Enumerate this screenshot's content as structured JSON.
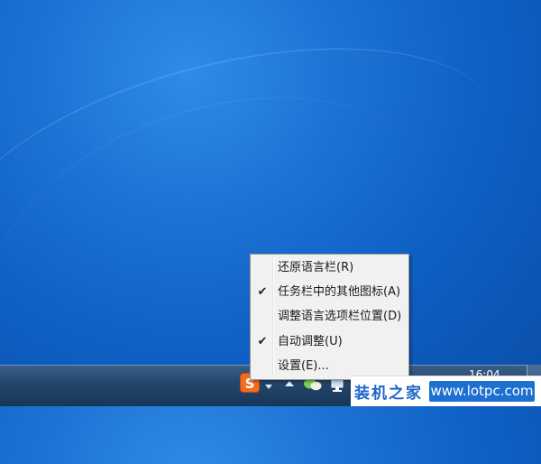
{
  "context_menu": {
    "items": [
      {
        "label": "还原语言栏(R)",
        "checked": false
      },
      {
        "label": "任务栏中的其他图标(A)",
        "checked": true
      },
      {
        "label": "调整语言选项栏位置(D)",
        "checked": false
      },
      {
        "label": "自动调整(U)",
        "checked": true
      },
      {
        "label": "设置(E)...",
        "checked": false
      }
    ],
    "check_mark": "✔"
  },
  "tray": {
    "ime_label": "S",
    "icons": [
      "sogou-ime-icon",
      "dropdown-arrow-icon",
      "show-hidden-icons-arrow",
      "wechat-icon",
      "network-icon"
    ]
  },
  "clock": {
    "time": "16:04"
  },
  "watermark": {
    "left_text": "装机之家",
    "right_text": "www.lotpc.com"
  },
  "colors": {
    "desktop": "#1d73d4",
    "taskbar": "#24476d",
    "menu_bg": "#f1f1f1",
    "ime": "#f26b22"
  }
}
